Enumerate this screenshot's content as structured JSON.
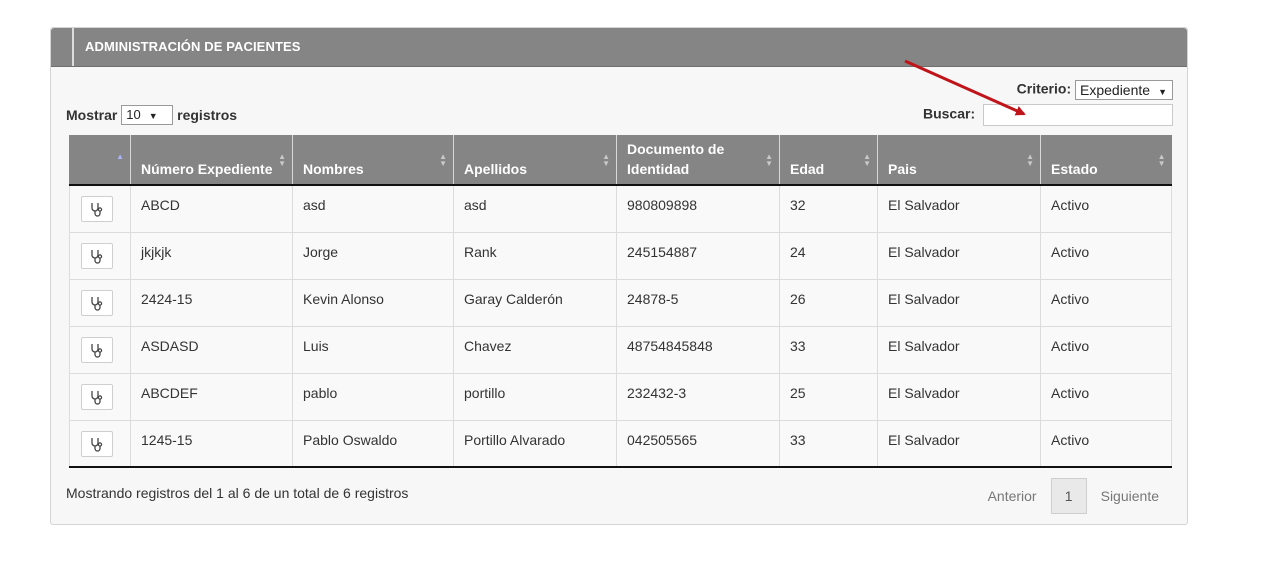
{
  "panel": {
    "title": "ADMINISTRACIÓN DE PACIENTES"
  },
  "length": {
    "prefix": "Mostrar",
    "value": "10",
    "suffix": "registros"
  },
  "criterio": {
    "label": "Criterio:",
    "value": "Expediente"
  },
  "search": {
    "label": "Buscar:",
    "value": "",
    "placeholder": ""
  },
  "table": {
    "columns": [
      "",
      "Número Expediente",
      "Nombres",
      "Apellidos",
      "Documento de Identidad",
      "Edad",
      "Pais",
      "Estado"
    ],
    "rows": [
      [
        "ABCD",
        "asd",
        "asd",
        "980809898",
        "32",
        "El Salvador",
        "Activo"
      ],
      [
        "jkjkjk",
        "Jorge",
        "Rank",
        "245154887",
        "24",
        "El Salvador",
        "Activo"
      ],
      [
        "2424-15",
        "Kevin Alonso",
        "Garay Calderón",
        "24878-5",
        "26",
        "El Salvador",
        "Activo"
      ],
      [
        "ASDASD",
        "Luis",
        "Chavez",
        "48754845848",
        "33",
        "El Salvador",
        "Activo"
      ],
      [
        "ABCDEF",
        "pablo",
        "portillo",
        "232432-3",
        "25",
        "El Salvador",
        "Activo"
      ],
      [
        "1245-15",
        "Pablo Oswaldo",
        "Portillo Alvarado",
        "042505565",
        "33",
        "El Salvador",
        "Activo"
      ]
    ],
    "row_action_icon": "stethoscope-icon"
  },
  "footer": {
    "info": "Mostrando registros del 1 al 6 de un total de 6 registros",
    "prev": "Anterior",
    "page": "1",
    "next": "Siguiente"
  },
  "colors": {
    "header_bg": "#858585",
    "annotation_arrow": "#c0141b"
  }
}
